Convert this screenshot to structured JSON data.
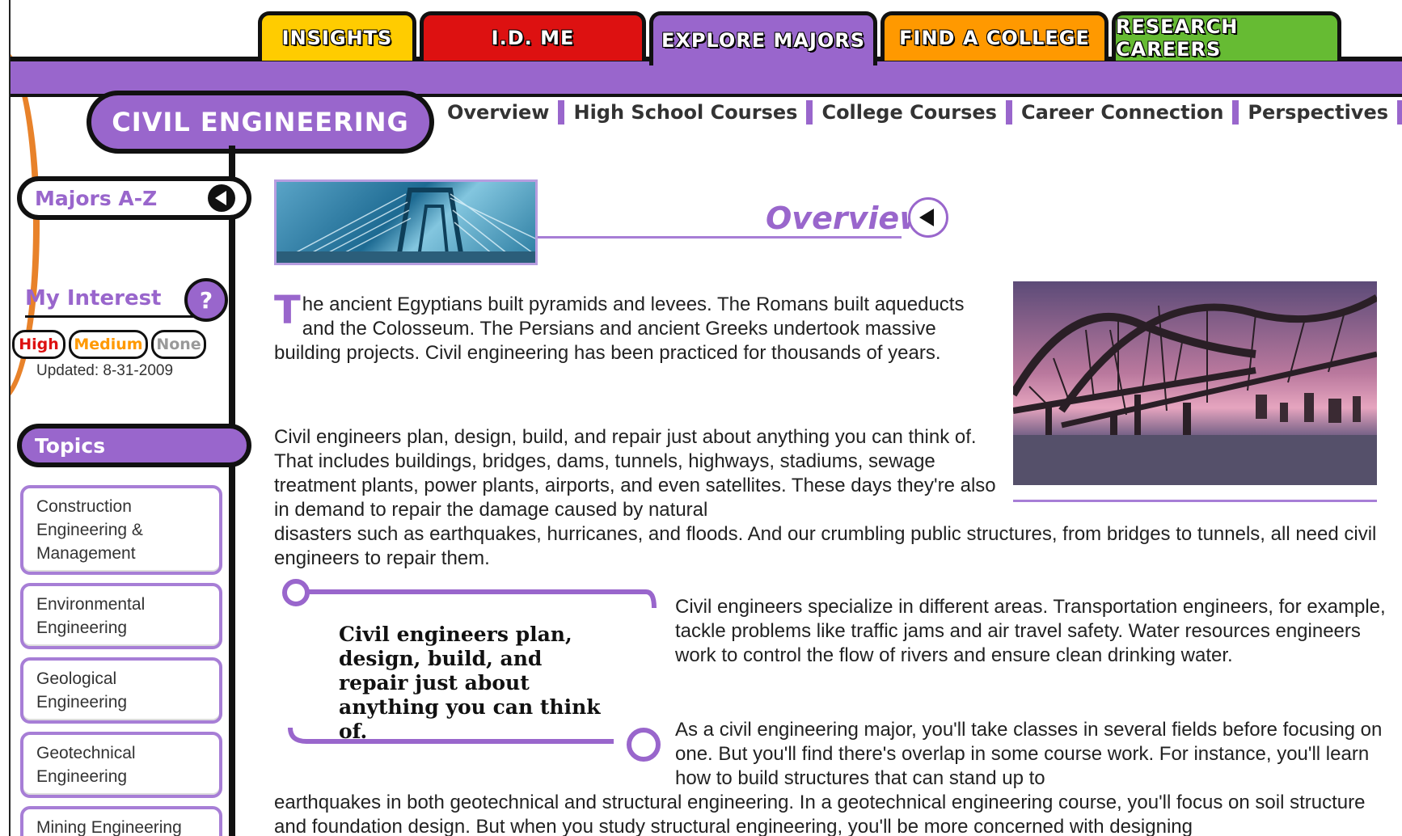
{
  "nav": {
    "tabs": [
      {
        "label": "INSIGHTS",
        "color": "#ffcc00",
        "active": false
      },
      {
        "label": "I.D. ME",
        "color": "#dd1111",
        "active": false
      },
      {
        "label": "EXPLORE MAJORS",
        "color": "#9966cc",
        "active": true
      },
      {
        "label": "FIND A COLLEGE",
        "color": "#ff9900",
        "active": false
      },
      {
        "label": "RESEARCH CAREERS",
        "color": "#66bb33",
        "active": false
      }
    ]
  },
  "page": {
    "title": "CIVIL ENGINEERING",
    "subnav": [
      "Overview",
      "High School Courses",
      "College Courses",
      "Career Connection",
      "Perspectives"
    ],
    "section_heading": "Overview"
  },
  "sidebar": {
    "majors_label": "Majors A-Z",
    "interest_label": "My Interest",
    "help_symbol": "?",
    "levels": [
      {
        "label": "High",
        "color": "#dd1111"
      },
      {
        "label": "Medium",
        "color": "#ff9900"
      },
      {
        "label": "None",
        "color": "#999999"
      }
    ],
    "updated": "Updated: 8-31-2009",
    "topics_label": "Topics",
    "topics": [
      "Construction Engineering & Management",
      "Environmental Engineering",
      "Geological Engineering",
      "Geotechnical Engineering",
      "Mining Engineering"
    ]
  },
  "content": {
    "dropcap": "T",
    "p1": "he ancient Egyptians built pyramids and levees. The Romans built aqueducts and the Colosseum. The Persians and ancient Greeks undertook massive building projects. Civil engineering has been practiced for thousands of years.",
    "p2a": "Civil engineers plan, design, build, and repair just about anything you can think of. That includes buildings, bridges, dams, tunnels, highways, stadiums, sewage treatment plants, power plants, airports, and even satellites. These days they're also in demand to repair the damage caused by natural",
    "p2b": "disasters such as earthquakes, hurricanes, and floods. And our crumbling public structures, from bridges to tunnels, all need civil engineers to repair them.",
    "pull_quote": "Civil engineers plan, design, build, and repair just about anything you can think of.",
    "p3": "Civil engineers specialize in different areas. Transportation engineers, for example, tackle problems like traffic jams and air travel safety. Water resources engineers work to control the flow of rivers and ensure clean drinking water.",
    "p4a": "As a civil engineering major, you'll take classes in several fields before focusing on one. But you'll find there's overlap in some course work. For instance, you'll learn how to build structures that can stand up to",
    "p4b": "earthquakes in both geotechnical and structural engineering. In a geotechnical engineering course, you'll focus on soil structure and foundation design. But when you study structural engineering, you'll be more concerned with designing"
  },
  "colors": {
    "accent": "#9966cc",
    "accent_light": "#a77ed6",
    "border": "#111111"
  }
}
